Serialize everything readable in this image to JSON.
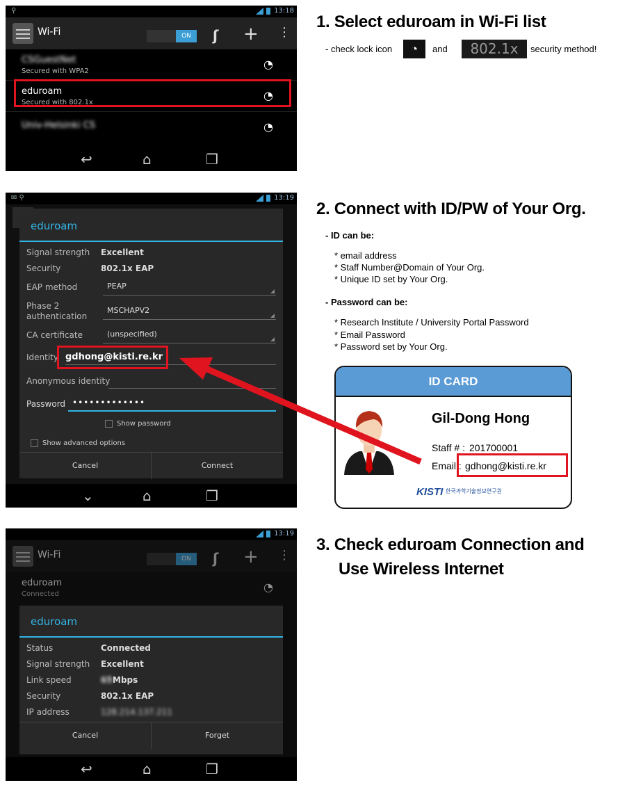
{
  "step1": {
    "title": "1. Select eduroam in Wi-Fi list",
    "note_prefix": "- check lock icon",
    "note_and": "and",
    "note_badge": "802.1x",
    "note_suffix": "security method!"
  },
  "step2": {
    "title": "2. Connect with ID/PW of Your Org.",
    "id_heading": "- ID can be:",
    "id_items": [
      "* email address",
      "* Staff Number@Domain of Your Org.",
      "* Unique ID set by Your Org."
    ],
    "pw_heading": "- Password can be:",
    "pw_items": [
      "* Research Institute / University Portal Password",
      "* Email Password",
      "* Password set by Your Org."
    ]
  },
  "step3": {
    "title_line1": "3. Check eduroam Connection and",
    "title_line2": "Use Wireless Internet"
  },
  "id_card": {
    "header": "ID CARD",
    "name": "Gil-Dong Hong",
    "staff_label": "Staff # :",
    "staff_number": "201700001",
    "email_label": "Email :",
    "email": "gdhong@kisti.re.kr",
    "logo_text": "KISTI",
    "logo_korean": "한국과학기술정보연구원",
    "colors": {
      "header_bg": "#5b9bd5",
      "highlight": "#e0141e"
    }
  },
  "screen1": {
    "status_time": "13:18",
    "action_title": "Wi-Fi",
    "toggle_label": "ON",
    "networks": [
      {
        "name": "CSGuestNet",
        "sub": "Secured with WPA2"
      },
      {
        "name": "eduroam",
        "sub": "Secured with 802.1x"
      },
      {
        "name": "Univ-Helsinki CS",
        "sub": ""
      }
    ]
  },
  "screen2": {
    "status_time": "13:19",
    "dialog_title": "eduroam",
    "signal_label": "Signal strength",
    "signal_value": "Excellent",
    "security_label": "Security",
    "security_value": "802.1x EAP",
    "eap_label": "EAP method",
    "eap_value": "PEAP",
    "phase2_label_1": "Phase 2",
    "phase2_label_2": "authentication",
    "phase2_value": "MSCHAPV2",
    "ca_label": "CA certificate",
    "ca_value": "(unspecified)",
    "identity_label": "Identity",
    "identity_value": "gdhong@kisti.re.kr",
    "anon_label": "Anonymous identity",
    "password_label": "Password",
    "password_value": "•••••••••••••",
    "show_password": "Show password",
    "show_advanced": "Show advanced options",
    "cancel": "Cancel",
    "connect": "Connect"
  },
  "screen3": {
    "status_time": "13:19",
    "action_title": "Wi-Fi",
    "toggle_label": "ON",
    "network_name": "eduroam",
    "network_sub": "Connected",
    "dialog_title": "eduroam",
    "status_label": "Status",
    "status_value": "Connected",
    "signal_label": "Signal strength",
    "signal_value": "Excellent",
    "link_label": "Link speed",
    "link_value_num": "65",
    "link_value_unit": "Mbps",
    "security_label": "Security",
    "security_value": "802.1x EAP",
    "ip_label": "IP address",
    "ip_value": "128.214.137.211",
    "cancel": "Cancel",
    "forget": "Forget"
  }
}
